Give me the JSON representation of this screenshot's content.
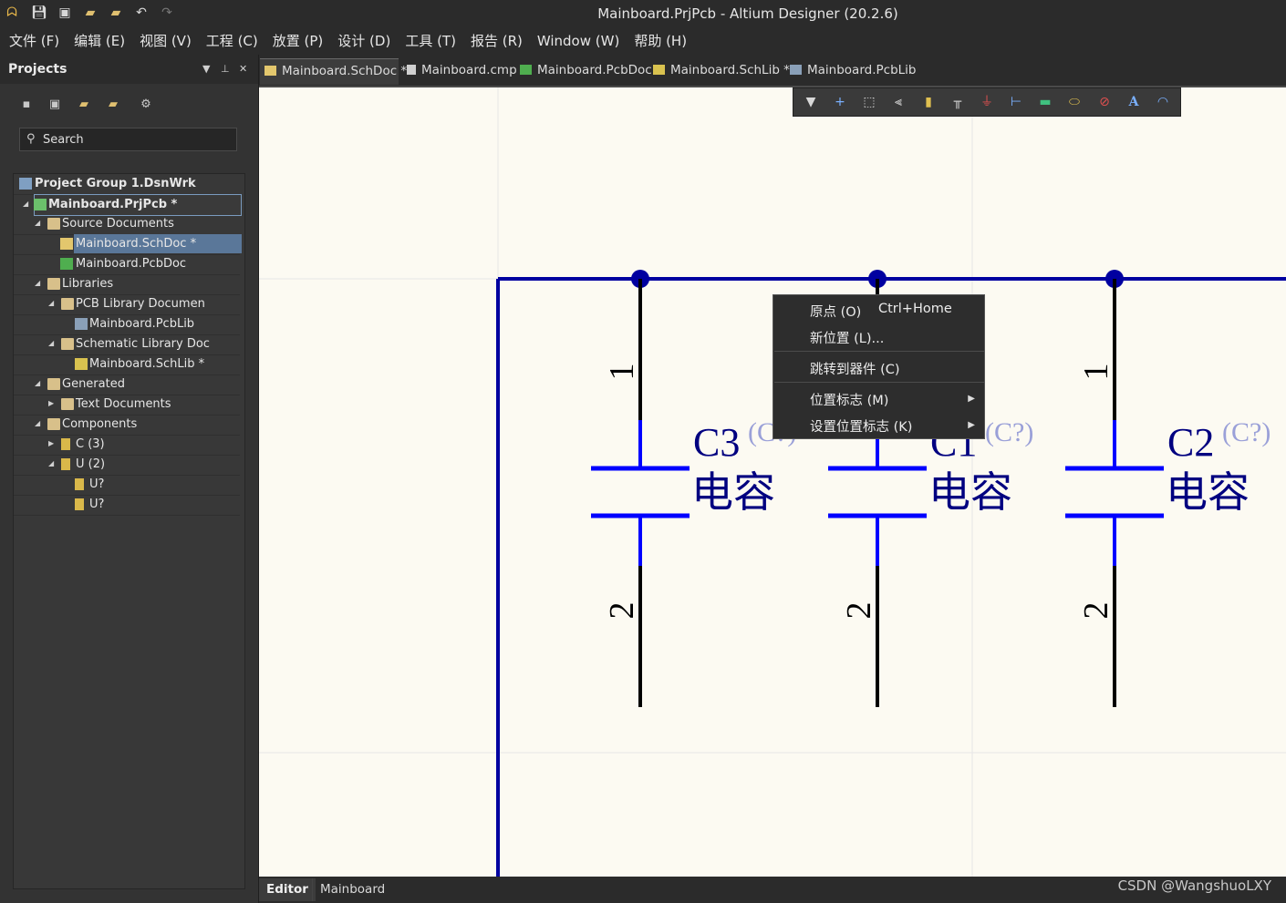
{
  "window": {
    "title": "Mainboard.PrjPcb - Altium Designer (20.2.6)"
  },
  "quick_toolbar": {
    "icons": [
      "altium-logo-icon",
      "save-icon",
      "save-all-icon",
      "open-icon",
      "open-project-icon",
      "undo-icon",
      "redo-icon"
    ]
  },
  "menu": [
    "文件 (F)",
    "编辑 (E)",
    "视图 (V)",
    "工程 (C)",
    "放置 (P)",
    "设计 (D)",
    "工具 (T)",
    "报告 (R)",
    "Window (W)",
    "帮助 (H)"
  ],
  "panel": {
    "title": "Projects",
    "search_placeholder": "Search",
    "tree": [
      {
        "label": "Project Group 1.DsnWrk",
        "bold": true
      },
      {
        "label": "Mainboard.PrjPcb *",
        "bold": true
      },
      {
        "label": "Source Documents"
      },
      {
        "label": "Mainboard.SchDoc *",
        "selected": true
      },
      {
        "label": "Mainboard.PcbDoc"
      },
      {
        "label": "Libraries"
      },
      {
        "label": "PCB Library Documen"
      },
      {
        "label": "Mainboard.PcbLib"
      },
      {
        "label": "Schematic Library Doc"
      },
      {
        "label": "Mainboard.SchLib *"
      },
      {
        "label": "Generated"
      },
      {
        "label": "Text Documents"
      },
      {
        "label": "Components"
      },
      {
        "label": "C (3)"
      },
      {
        "label": "U (2)"
      },
      {
        "label": "U?"
      },
      {
        "label": "U?"
      }
    ]
  },
  "tabs": [
    {
      "label": "Mainboard.SchDoc *",
      "active": true
    },
    {
      "label": "Mainboard.cmp"
    },
    {
      "label": "Mainboard.PcbDoc"
    },
    {
      "label": "Mainboard.SchLib *"
    },
    {
      "label": "Mainboard.PcbLib"
    }
  ],
  "schematic": {
    "components": [
      {
        "designator": "C3",
        "comment": "(C?)",
        "value": "电容",
        "pin1": "1",
        "pin2": "2"
      },
      {
        "designator": "C1",
        "comment": "(C?)",
        "value": "电容",
        "pin1": "1",
        "pin2": "2"
      },
      {
        "designator": "C2",
        "comment": "(C?)",
        "value": "电容",
        "pin1": "1",
        "pin2": "2"
      }
    ],
    "colors": {
      "wire": "#0000a0",
      "capacitor": "#0000ff",
      "pin": "#000000",
      "designator": "#000080",
      "comment": "#9aa0d8",
      "grid": "#e6e6e6",
      "sheet": "#fcfaf2"
    }
  },
  "context_menu": {
    "items": [
      {
        "label": "原点 (O)",
        "shortcut": "Ctrl+Home"
      },
      {
        "label": "新位置 (L)..."
      },
      {
        "label": "跳转到器件 (C)"
      },
      {
        "label": "位置标志 (M)",
        "submenu": true
      },
      {
        "label": "设置位置标志 (K)",
        "submenu": true
      }
    ]
  },
  "status_tabs": [
    "Editor",
    "Mainboard"
  ],
  "watermark": "CSDN @WangshuoLXY"
}
